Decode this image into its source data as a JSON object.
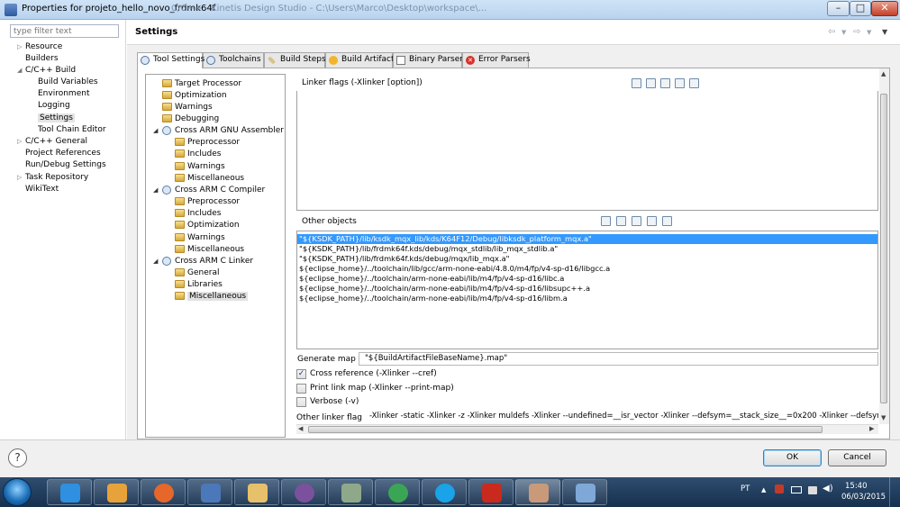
{
  "window": {
    "title": "Properties for projeto_hello_novo_frdmk64f",
    "background_title": "C/C++ - Kinetis Design Studio - C:\\Users\\Marco\\Desktop\\workspace\\..."
  },
  "filter": {
    "placeholder": "type filter text"
  },
  "nav": {
    "items": [
      {
        "label": "Resource",
        "expandable": true
      },
      {
        "label": "Builders",
        "expandable": false
      },
      {
        "label": "C/C++ Build",
        "expanded": true
      },
      {
        "label": "Build Variables",
        "child": true
      },
      {
        "label": "Environment",
        "child": true
      },
      {
        "label": "Logging",
        "child": true
      },
      {
        "label": "Settings",
        "child": true,
        "selected": true
      },
      {
        "label": "Tool Chain Editor",
        "child": true
      },
      {
        "label": "C/C++ General",
        "expandable": true
      },
      {
        "label": "Project References",
        "expandable": false
      },
      {
        "label": "Run/Debug Settings",
        "expandable": false
      },
      {
        "label": "Task Repository",
        "expandable": true
      },
      {
        "label": "WikiText",
        "expandable": false
      }
    ]
  },
  "header": {
    "title": "Settings"
  },
  "tabs": [
    {
      "label": "Tool Settings",
      "active": true
    },
    {
      "label": "Toolchains"
    },
    {
      "label": "Build Steps"
    },
    {
      "label": "Build Artifact"
    },
    {
      "label": "Binary Parsers"
    },
    {
      "label": "Error Parsers"
    }
  ],
  "tree": [
    {
      "label": "Target Processor",
      "level": 1
    },
    {
      "label": "Optimization",
      "level": 1
    },
    {
      "label": "Warnings",
      "level": 1
    },
    {
      "label": "Debugging",
      "level": 1
    },
    {
      "label": "Cross ARM GNU Assembler",
      "level": 0
    },
    {
      "label": "Preprocessor",
      "level": 2
    },
    {
      "label": "Includes",
      "level": 2
    },
    {
      "label": "Warnings",
      "level": 2
    },
    {
      "label": "Miscellaneous",
      "level": 2
    },
    {
      "label": "Cross ARM C Compiler",
      "level": 0
    },
    {
      "label": "Preprocessor",
      "level": 2
    },
    {
      "label": "Includes",
      "level": 2
    },
    {
      "label": "Optimization",
      "level": 2
    },
    {
      "label": "Warnings",
      "level": 2
    },
    {
      "label": "Miscellaneous",
      "level": 2
    },
    {
      "label": "Cross ARM C Linker",
      "level": 0
    },
    {
      "label": "General",
      "level": 2
    },
    {
      "label": "Libraries",
      "level": 2
    },
    {
      "label": "Miscellaneous",
      "level": 2,
      "selected": true
    }
  ],
  "linker_flags": {
    "label": "Linker flags (-Xlinker [option])"
  },
  "other_objects": {
    "label": "Other objects",
    "items": [
      "\"${KSDK_PATH}/lib/ksdk_mqx_lib/kds/K64F12/Debug/libksdk_platform_mqx.a\"",
      "\"${KSDK_PATH}/lib/frdmk64f.kds/debug/mqx_stdlib/lib_mqx_stdlib.a\"",
      "\"${KSDK_PATH}/lib/frdmk64f.kds/debug/mqx/lib_mqx.a\"",
      "${eclipse_home}/../toolchain/lib/gcc/arm-none-eabi/4.8.0/m4/fp/v4-sp-d16/libgcc.a",
      "${eclipse_home}/../toolchain/arm-none-eabi/lib/m4/fp/v4-sp-d16/libc.a",
      "${eclipse_home}/../toolchain/arm-none-eabi/lib/m4/fp/v4-sp-d16/libsupc++.a",
      "${eclipse_home}/../toolchain/arm-none-eabi/lib/m4/fp/v4-sp-d16/libm.a"
    ],
    "selected_index": 0
  },
  "generate_map": {
    "label": "Generate map",
    "value": "\"${BuildArtifactFileBaseName}.map\""
  },
  "checkboxes": [
    {
      "label": "Cross reference (-Xlinker --cref)",
      "checked": true
    },
    {
      "label": "Print link map (-Xlinker --print-map)",
      "checked": false
    },
    {
      "label": "Verbose (-v)",
      "checked": false
    }
  ],
  "other_linker_flags": {
    "label": "Other linker flags",
    "value": "-Xlinker -static  -Xlinker -z -Xlinker muldefs  -Xlinker --undefined=__isr_vector  -Xlinker --defsym=__stack_size__=0x200  -Xlinker --defsym=__heap_"
  },
  "buttons": {
    "ok": "OK",
    "cancel": "Cancel",
    "help": "?"
  },
  "taskbar": {
    "apps": [
      "internet-explorer",
      "media-player",
      "firefox",
      "thunderbird",
      "file-explorer",
      "viber",
      "kinetis-design-studio",
      "chrome",
      "skype",
      "acrobat",
      "image-viewer",
      "paint"
    ],
    "active_app": "image-viewer",
    "language": "PT",
    "time": "15:40",
    "date": "06/03/2015"
  }
}
